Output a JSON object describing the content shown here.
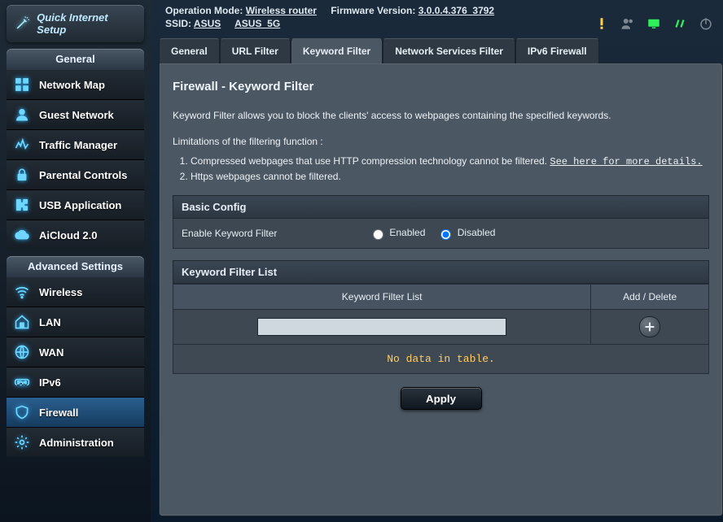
{
  "quick_setup": "Quick Internet Setup",
  "sections": {
    "general": "General",
    "advanced": "Advanced Settings"
  },
  "nav_general": [
    {
      "icon": "tiles",
      "label": "Network Map"
    },
    {
      "icon": "user",
      "label": "Guest Network"
    },
    {
      "icon": "wave",
      "label": "Traffic Manager"
    },
    {
      "icon": "lock",
      "label": "Parental Controls"
    },
    {
      "icon": "puzzle",
      "label": "USB Application"
    },
    {
      "icon": "cloud",
      "label": "AiCloud 2.0"
    }
  ],
  "nav_advanced": [
    {
      "icon": "wifi",
      "label": "Wireless",
      "active": false
    },
    {
      "icon": "house",
      "label": "LAN",
      "active": false
    },
    {
      "icon": "globe",
      "label": "WAN",
      "active": false
    },
    {
      "icon": "ipv6",
      "label": "IPv6",
      "active": false
    },
    {
      "icon": "shield",
      "label": "Firewall",
      "active": true
    },
    {
      "icon": "gear",
      "label": "Administration",
      "active": false
    }
  ],
  "header": {
    "op_mode_label": "Operation Mode:",
    "op_mode_value": "Wireless router",
    "fw_label": "Firmware Version:",
    "fw_value": "3.0.0.4.376_3792",
    "ssid_label": "SSID:",
    "ssid1": "ASUS",
    "ssid2": "ASUS_5G"
  },
  "tabs": [
    {
      "label": "General",
      "active": false
    },
    {
      "label": "URL Filter",
      "active": false
    },
    {
      "label": "Keyword Filter",
      "active": true
    },
    {
      "label": "Network Services Filter",
      "active": false
    },
    {
      "label": "IPv6 Firewall",
      "active": false
    }
  ],
  "page": {
    "title": "Firewall - Keyword Filter",
    "intro": "Keyword Filter allows you to block the clients' access to webpages containing the specified keywords.",
    "limits_label": "Limitations of the filtering function :",
    "limits": [
      "Compressed webpages that use HTTP compression technology cannot be filtered.",
      "Https webpages cannot be filtered."
    ],
    "more_link": "See here for more details.",
    "basic_config": "Basic Config",
    "enable_row_label": "Enable Keyword Filter",
    "enabled_label": "Enabled",
    "disabled_label": "Disabled",
    "enable_value": "disabled",
    "list_header": "Keyword Filter List",
    "col_keyword": "Keyword Filter List",
    "col_add": "Add / Delete",
    "keyword_input": "",
    "nodata": "No data in table.",
    "apply": "Apply"
  },
  "status_icons": [
    "warn",
    "users",
    "net",
    "link",
    "power"
  ]
}
